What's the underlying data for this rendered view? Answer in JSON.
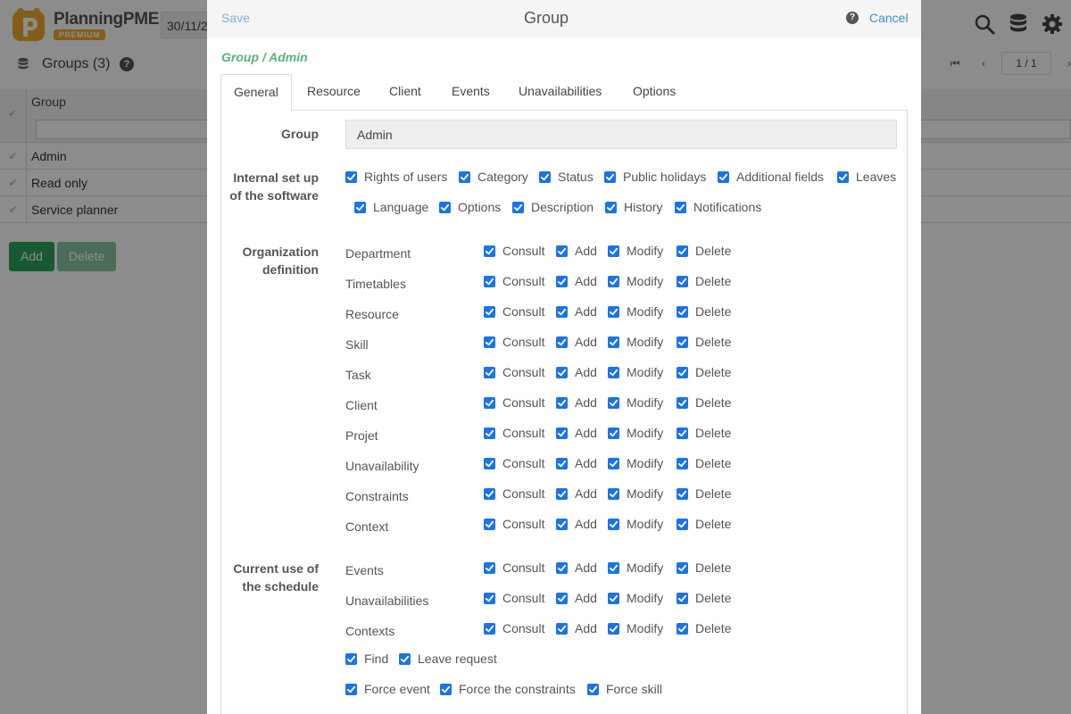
{
  "app": {
    "logo_text": "PlanningPME",
    "logo_badge": "PREMIUM",
    "date_value": "30/11/2"
  },
  "subbar": {
    "title": "Groups (3)",
    "help": "?",
    "pager_value": "1 / 1"
  },
  "grid": {
    "column_header": "Group",
    "rows": [
      "Admin",
      "Read only",
      "Service planner"
    ],
    "add_label": "Add",
    "delete_label": "Delete"
  },
  "modal": {
    "save_label": "Save",
    "title": "Group",
    "help": "?",
    "cancel_label": "Cancel",
    "breadcrumb": "Group / Admin",
    "tabs": [
      "General",
      "Resource",
      "Client",
      "Events",
      "Unavailabilities",
      "Options"
    ],
    "active_tab": "General",
    "group_label": "Group",
    "group_value": "Admin",
    "internal_label_1": "Internal set up",
    "internal_label_2": "of the software",
    "internal_row1": [
      "Rights of users",
      "Category",
      "Status",
      "Public holidays",
      "Additional fields",
      "Leaves"
    ],
    "internal_row2": [
      "Language",
      "Options",
      "Description",
      "History",
      "Notifications"
    ],
    "org_label_1": "Organization",
    "org_label_2": "definition",
    "org_rows": [
      "Department",
      "Timetables",
      "Resource",
      "Skill",
      "Task",
      "Client",
      "Projet",
      "Unavailability",
      "Constraints",
      "Context"
    ],
    "current_label_1": "Current use of",
    "current_label_2": "the schedule",
    "current_rows": [
      "Events",
      "Unavailabilities",
      "Contexts"
    ],
    "perms": [
      "Consult",
      "Add",
      "Modify",
      "Delete"
    ],
    "extra_row1": [
      "Find",
      "Leave request"
    ],
    "extra_row2": [
      "Force event",
      "Force the constraints",
      "Force skill"
    ]
  },
  "colors": {
    "accent_blue": "#1a73e8",
    "green_button": "#2aa55a",
    "breadcrumb_green": "#5ab27a",
    "cancel_link": "#3b8fd1"
  }
}
